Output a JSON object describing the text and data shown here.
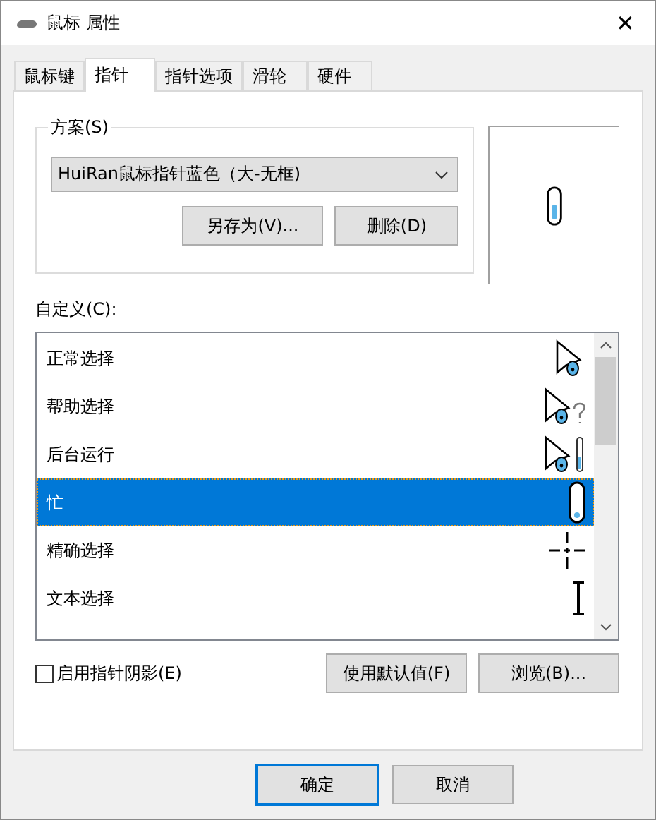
{
  "window": {
    "title": "鼠标 属性",
    "close": "✕"
  },
  "tabs": [
    {
      "label": "鼠标键",
      "selected": false
    },
    {
      "label": "指针",
      "selected": true
    },
    {
      "label": "指针选项",
      "selected": false
    },
    {
      "label": "滑轮",
      "selected": false
    },
    {
      "label": "硬件",
      "selected": false
    }
  ],
  "scheme": {
    "legend": "方案(S)",
    "value": "HuiRan鼠标指针蓝色（大-无框)",
    "buttons": [
      "另存为(V)...",
      "删除(D)"
    ]
  },
  "customize": {
    "label": "自定义(C):",
    "rows": [
      {
        "name": "正常选择",
        "kind": "arrow",
        "selected": false
      },
      {
        "name": "帮助选择",
        "kind": "help",
        "selected": false
      },
      {
        "name": "后台运行",
        "kind": "working",
        "selected": false
      },
      {
        "name": "忙",
        "kind": "busy",
        "selected": true
      },
      {
        "name": "精确选择",
        "kind": "crosshair",
        "selected": false
      },
      {
        "name": "文本选择",
        "kind": "text",
        "selected": false
      }
    ]
  },
  "shadow": {
    "label": "启用指针阴影(E)",
    "checked": false
  },
  "list_buttons": [
    "使用默认值(F)",
    "浏览(B)..."
  ],
  "footer_buttons": [
    {
      "label": "确定",
      "default": true
    },
    {
      "label": "取消",
      "default": false
    }
  ]
}
